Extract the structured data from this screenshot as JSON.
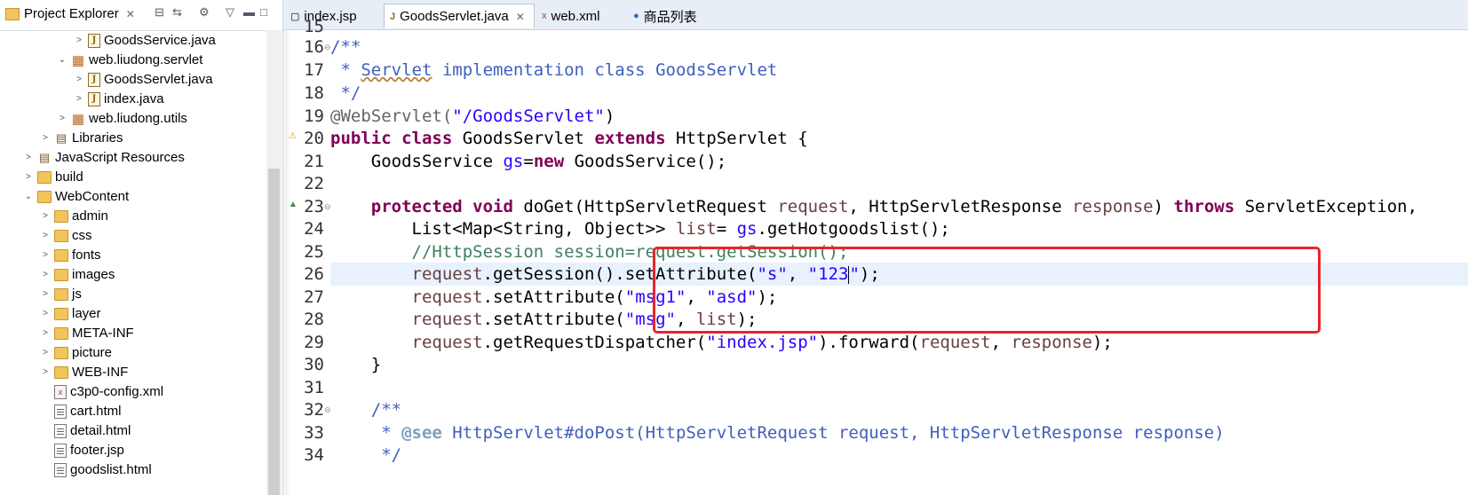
{
  "explorer": {
    "title": "Project Explorer",
    "tree": [
      {
        "label": "GoodsService.java",
        "icon": "java-file-icon"
      },
      {
        "label": "web.liudong.servlet",
        "icon": "package-icon"
      },
      {
        "label": "GoodsServlet.java",
        "icon": "java-file-icon"
      },
      {
        "label": "index.java",
        "icon": "java-file-icon"
      },
      {
        "label": "web.liudong.utils",
        "icon": "package-icon"
      },
      {
        "label": "Libraries",
        "icon": "library-icon"
      },
      {
        "label": "JavaScript Resources",
        "icon": "library-icon"
      },
      {
        "label": "build",
        "icon": "folder-icon"
      },
      {
        "label": "WebContent",
        "icon": "folder-icon"
      },
      {
        "label": "admin",
        "icon": "folder-icon"
      },
      {
        "label": "css",
        "icon": "folder-icon"
      },
      {
        "label": "fonts",
        "icon": "folder-icon"
      },
      {
        "label": "images",
        "icon": "folder-icon"
      },
      {
        "label": "js",
        "icon": "folder-icon"
      },
      {
        "label": "layer",
        "icon": "folder-icon"
      },
      {
        "label": "META-INF",
        "icon": "folder-icon"
      },
      {
        "label": "picture",
        "icon": "folder-icon"
      },
      {
        "label": "WEB-INF",
        "icon": "folder-icon"
      },
      {
        "label": "c3p0-config.xml",
        "icon": "xml-file-icon"
      },
      {
        "label": "cart.html",
        "icon": "html-file-icon"
      },
      {
        "label": "detail.html",
        "icon": "html-file-icon"
      },
      {
        "label": "footer.jsp",
        "icon": "jsp-file-icon"
      },
      {
        "label": "goodslist.html",
        "icon": "html-file-icon"
      }
    ]
  },
  "tabs": [
    {
      "label": "index.jsp"
    },
    {
      "label": "GoodsServlet.java"
    },
    {
      "label": "web.xml"
    },
    {
      "label": "商品列表"
    }
  ],
  "gutter": {
    "line_numbers": [
      "15",
      "16",
      "17",
      "18",
      "19",
      "20",
      "21",
      "22",
      "23",
      "24",
      "25",
      "26",
      "27",
      "28",
      "29",
      "30",
      "31",
      "32",
      "33",
      "34"
    ]
  },
  "code": {
    "l16": "/**",
    "l17a": " * ",
    "l17b": "Servlet",
    "l17c": " implementation class GoodsServlet",
    "l18": " */",
    "l19a": "@WebServlet(",
    "l19b": "\"/GoodsServlet\"",
    "l19c": ")",
    "l20a": "public class",
    "l20b": " GoodsServlet ",
    "l20c": "extends",
    "l20d": " HttpServlet {",
    "l21a": "    GoodsService ",
    "l21b": "gs",
    "l21c": "=",
    "l21d": "new",
    "l21e": " GoodsService();",
    "l23a": "    ",
    "l23b": "protected void",
    "l23c": " doGet(HttpServletRequest ",
    "l23d": "request",
    "l23e": ", HttpServletResponse ",
    "l23f": "response",
    "l23g": ") ",
    "l23h": "throws",
    "l23i": " ServletException,",
    "l24a": "        List<Map<String, Object>> ",
    "l24b": "list",
    "l24c": "= ",
    "l24d": "gs",
    "l24e": ".getHotgoodslist();",
    "l25": "        //HttpSession session=request.getSession();",
    "l26a": "        ",
    "l26b": "request",
    "l26c": ".getSession().setAttribute(",
    "l26d": "\"s\"",
    "l26e": ", ",
    "l26f": "\"123",
    "l26g": "\"",
    "l26h": ");",
    "l27a": "        ",
    "l27b": "request",
    "l27c": ".setAttribute(",
    "l27d": "\"msg1\"",
    "l27e": ", ",
    "l27f": "\"asd\"",
    "l27g": ");",
    "l28a": "        ",
    "l28b": "request",
    "l28c": ".setAttribute(",
    "l28d": "\"msg\"",
    "l28e": ", ",
    "l28f": "list",
    "l28g": ");",
    "l29a": "        ",
    "l29b": "request",
    "l29c": ".getRequestDispatcher(",
    "l29d": "\"index.jsp\"",
    "l29e": ").forward(",
    "l29f": "request",
    "l29g": ", ",
    "l29h": "response",
    "l29i": ");",
    "l30": "    }",
    "l32": "    /**",
    "l33a": "     * ",
    "l33b": "@see",
    "l33c": " HttpServlet#doPost(HttpServletRequest request, HttpServletResponse response)",
    "l34": "     */"
  }
}
